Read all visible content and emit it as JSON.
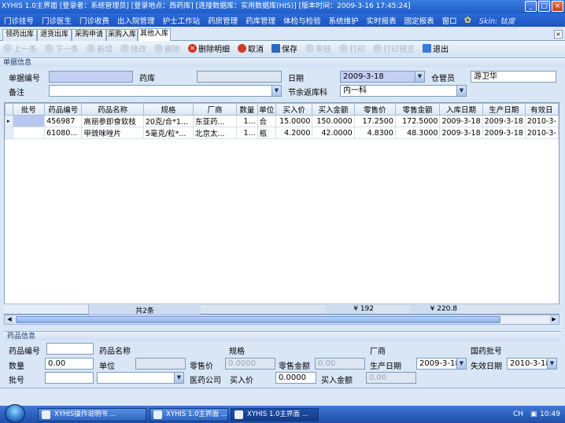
{
  "window": {
    "title": "XYHIS 1.0主界面   [登录者：系统管理员]  [登录地点：西药库]  [连接数据库：实用数据库(HIS)]  [版本时间：2009-3-16 17:45:24]",
    "minimize": "_",
    "maximize": "□",
    "close": "×"
  },
  "menu": {
    "items": [
      "门诊挂号",
      "门诊医生",
      "门诊收费",
      "出入院管理",
      "护士工作站",
      "药房管理",
      "药库管理",
      "体检与检验",
      "系统维护",
      "实时报表",
      "固定报表",
      "窗口"
    ],
    "skin_label": "Skin: 钛度"
  },
  "tabs": [
    {
      "label": "领药出库"
    },
    {
      "label": "退货出库"
    },
    {
      "label": "采购申请"
    },
    {
      "label": "采购入库"
    },
    {
      "label": "其他入库"
    }
  ],
  "tab_close": "×",
  "toolbar": {
    "first": "上一条",
    "next": "下一条",
    "add": "新增",
    "edit": "修改",
    "delete": "删除",
    "delete_detail": "删除明细",
    "cancel": "取消",
    "save": "保存",
    "audit": "审核",
    "print": "打印",
    "print_preview": "打印预览",
    "exit": "退出"
  },
  "doc": {
    "section": "单据信息",
    "bill_no_label": "单据编号",
    "bill_no": "",
    "warehouse_label": "药库",
    "warehouse": "",
    "date_label": "日期",
    "date": "2009-3-18",
    "keeper_label": "仓管员",
    "keeper": "游卫华",
    "remark_label": "备注",
    "remark": "",
    "dept_label": "节余返库科",
    "dept": "内一科"
  },
  "grid": {
    "columns": [
      "批号",
      "药品编号",
      "药品名称",
      "规格",
      "厂商",
      "数量",
      "单位",
      "买入价",
      "买入金额",
      "零售价",
      "零售金额",
      "入库日期",
      "生产日期",
      "有效日"
    ],
    "rows": [
      {
        "marker": "▸",
        "batch": "",
        "code": "456987",
        "name": "高丽参即食软枝",
        "spec": "20克/合*1...",
        "maker": "东亚药...",
        "qty": "1...",
        "unit": "合",
        "buy_price": "15.0000",
        "buy_amount": "150.0000",
        "retail_price": "17.2500",
        "retail_amount": "172.5000",
        "in_date": "2009-3-18",
        "prod_date": "2009-3-18",
        "exp": "2010-3-"
      },
      {
        "marker": "",
        "batch": "",
        "code": "61080...",
        "name": "甲巯咪唑片",
        "spec": "5毫克/粒*...",
        "maker": "北京太...",
        "qty": "1...",
        "unit": "瓶",
        "buy_price": "4.2000",
        "buy_amount": "42.0000",
        "retail_price": "4.8300",
        "retail_amount": "48.3000",
        "in_date": "2009-3-18",
        "prod_date": "2009-3-18",
        "exp": "2010-3-"
      }
    ],
    "footer_count": "共2条",
    "footer_buy_total": "¥ 192",
    "footer_retail_total": "¥ 220.8"
  },
  "detail": {
    "section": "药品信息",
    "code_label": "药品编号",
    "code": "",
    "name_label": "药品名称",
    "spec_label": "规格",
    "maker_label": "厂商",
    "approval_label": "国药批号",
    "qty_label": "数量",
    "qty": "0.00",
    "unit_label": "单位",
    "unit": "",
    "retail_price_label": "零售价",
    "retail_price": "0.0000",
    "retail_amount_label": "零售金额",
    "retail_amount": "0.00",
    "prod_date_label": "生产日期",
    "prod_date": "2009-3-18",
    "exp_date_label": "失效日期",
    "exp_date": "2010-3-18",
    "batch_label": "批号",
    "batch": "",
    "company_label": "医药公司",
    "buy_price_label": "买入价",
    "buy_price": "0.0000",
    "buy_amount_label": "买入金额",
    "buy_amount": "0.00"
  },
  "taskbar": {
    "tasks": [
      {
        "label": "XYHIS操作说明书 ..."
      },
      {
        "label": "XYHIS 1.0主界面 ..."
      },
      {
        "label": "XYHIS 1.0主界面 ..."
      }
    ],
    "ime": "CH",
    "clock": "10:49"
  }
}
